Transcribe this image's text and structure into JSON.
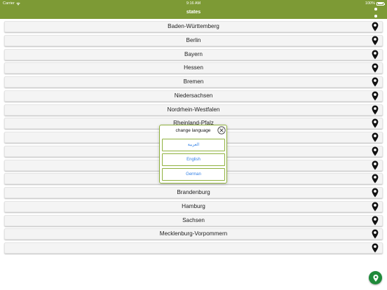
{
  "status_bar": {
    "carrier": "Carrier",
    "time": "9:16 AM",
    "battery": "100%"
  },
  "nav": {
    "title": "states",
    "menu_icon": "more-vertical-icon"
  },
  "states": [
    "Baden-Württemberg",
    "Berlin",
    "Bayern",
    "Hessen",
    "Bremen",
    "Niedersachsen",
    "Nordrhein-Westfalen",
    "Rheinland-Pfalz",
    "",
    "",
    "",
    "",
    "Brandenburg",
    "Hamburg",
    "Sachsen",
    "Mecklenburg-Vorpommern",
    ""
  ],
  "row_icon": "map-pin-icon",
  "dialog": {
    "title": "change language",
    "close_icon": "close-circle-icon",
    "options": [
      "العربية",
      "English",
      "German"
    ]
  },
  "fab": {
    "icon": "map-pin-icon"
  },
  "colors": {
    "header": "#7d9a35",
    "dialog_border": "#8fb13d",
    "option_text": "#2f7ee6",
    "fab": "#1f8a3a"
  }
}
